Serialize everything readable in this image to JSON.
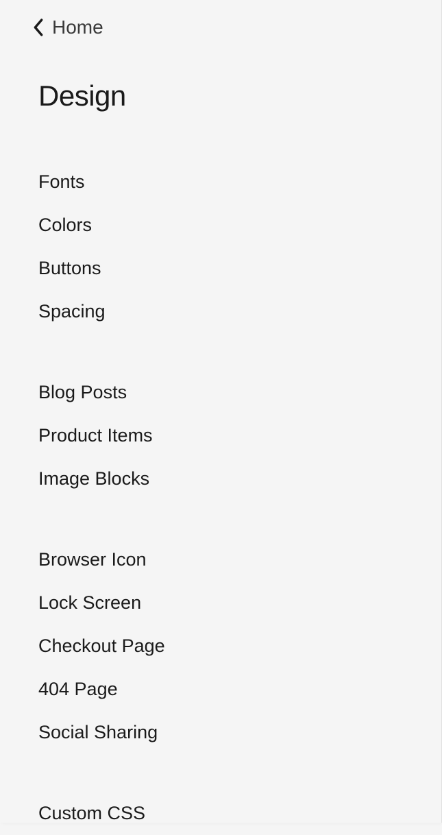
{
  "back": {
    "label": "Home"
  },
  "title": "Design",
  "groups": [
    {
      "items": [
        {
          "label": "Fonts",
          "name": "fonts"
        },
        {
          "label": "Colors",
          "name": "colors"
        },
        {
          "label": "Buttons",
          "name": "buttons"
        },
        {
          "label": "Spacing",
          "name": "spacing"
        }
      ]
    },
    {
      "items": [
        {
          "label": "Blog Posts",
          "name": "blog-posts"
        },
        {
          "label": "Product Items",
          "name": "product-items"
        },
        {
          "label": "Image Blocks",
          "name": "image-blocks"
        }
      ]
    },
    {
      "items": [
        {
          "label": "Browser Icon",
          "name": "browser-icon"
        },
        {
          "label": "Lock Screen",
          "name": "lock-screen"
        },
        {
          "label": "Checkout Page",
          "name": "checkout-page"
        },
        {
          "label": "404 Page",
          "name": "404-page"
        },
        {
          "label": "Social Sharing",
          "name": "social-sharing"
        }
      ]
    },
    {
      "items": [
        {
          "label": "Custom CSS",
          "name": "custom-css"
        }
      ]
    }
  ]
}
